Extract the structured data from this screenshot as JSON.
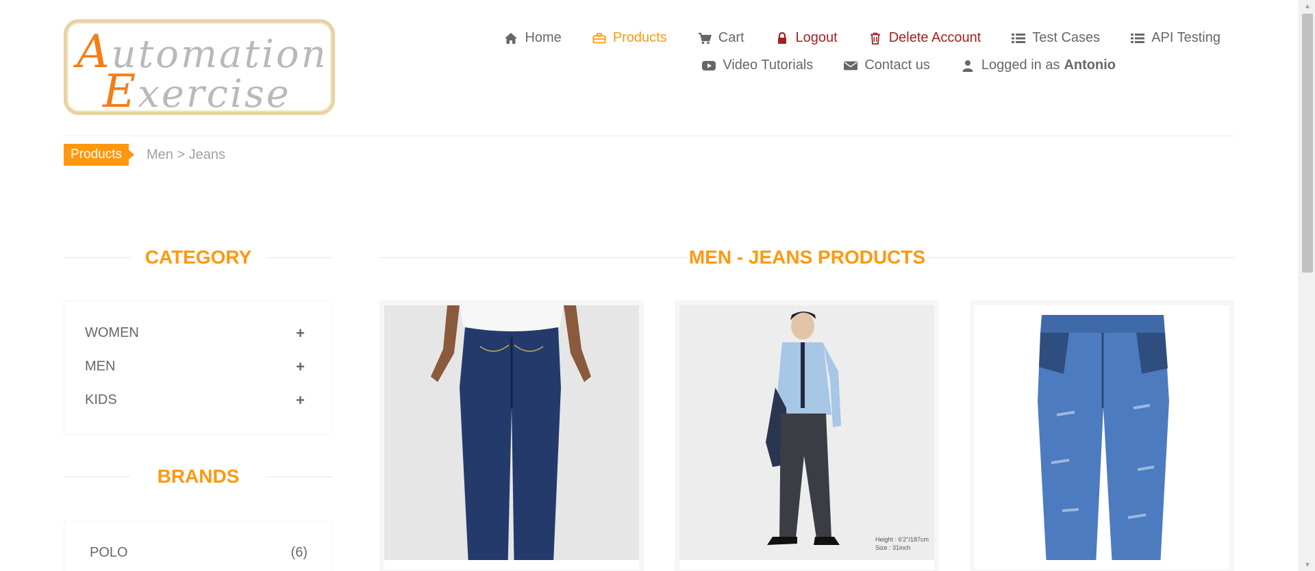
{
  "logo": {
    "line1_cap": "A",
    "line1_rest": "utomation",
    "line2_cap": "E",
    "line2_rest": "xercise"
  },
  "nav": {
    "row1": [
      {
        "label": "Home",
        "icon": "home-icon"
      },
      {
        "label": "Products",
        "icon": "briefcase-icon",
        "state": "active"
      },
      {
        "label": "Cart",
        "icon": "cart-icon"
      },
      {
        "label": "Logout",
        "icon": "lock-icon"
      },
      {
        "label": "Delete Account",
        "icon": "trash-icon"
      },
      {
        "label": "Test Cases",
        "icon": "list-icon"
      },
      {
        "label": "API Testing",
        "icon": "list-icon"
      }
    ],
    "row2": [
      {
        "label": "Video Tutorials",
        "icon": "youtube-play-icon"
      },
      {
        "label": "Contact us",
        "icon": "envelope-icon"
      },
      {
        "label": "Logged in as",
        "icon": "user-icon",
        "user": "Antonio"
      }
    ]
  },
  "breadcrumb": {
    "active": "Products",
    "rest": "Men > Jeans"
  },
  "sidebar": {
    "category_title": "CATEGORY",
    "categories": [
      "WOMEN",
      "MEN",
      "KIDS"
    ],
    "brands_title": "BRANDS",
    "brands": [
      {
        "name": "POLO",
        "count": "(6)"
      }
    ]
  },
  "main": {
    "title": "MEN - JEANS PRODUCTS"
  },
  "product_images": [
    {
      "alt": "jeans product"
    },
    {
      "alt": "jeans product",
      "caption1": "Height : 6'2\"/187cm",
      "caption2": "Size : 31inch"
    },
    {
      "alt": "jeans product"
    }
  ],
  "colors": {
    "accent": "#fe980f",
    "danger": "#a52020",
    "text": "#696763",
    "muted": "#a0a0a0"
  }
}
